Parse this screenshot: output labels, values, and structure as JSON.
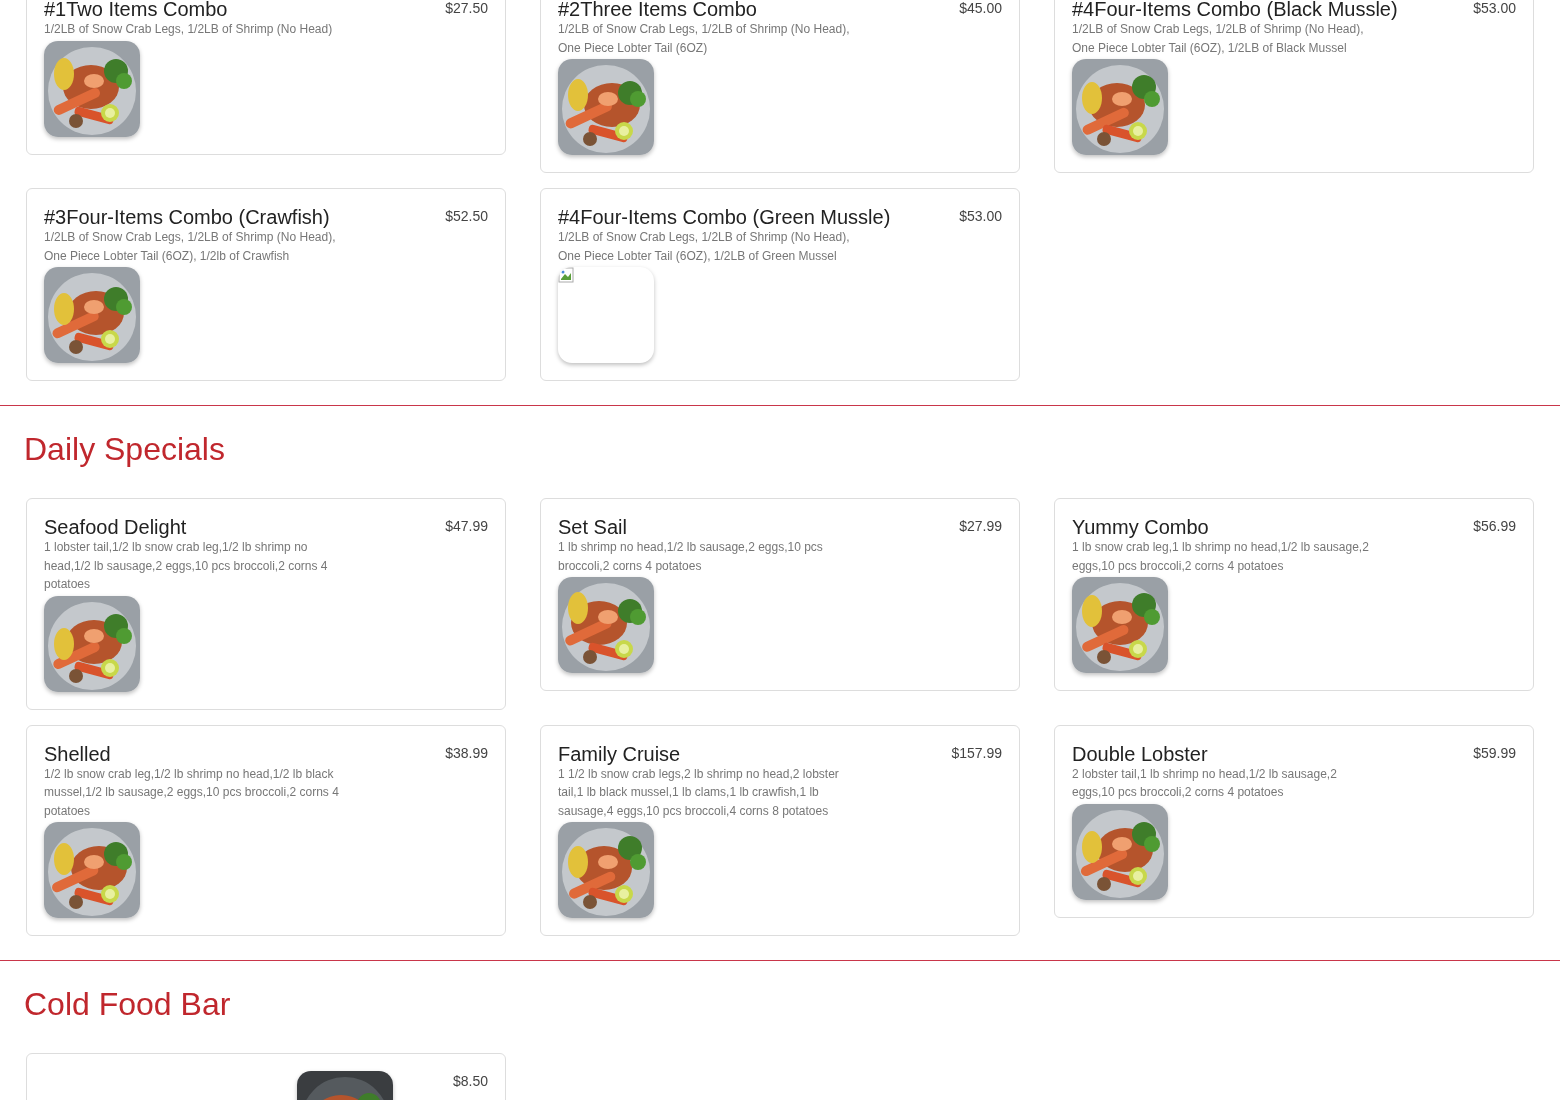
{
  "sections": [
    {
      "items": [
        {
          "kind": "standard",
          "name": "#1Two Items Combo",
          "price": "$27.50",
          "description": "1/2LB of Snow Crab Legs, 1/2LB of Shrimp (No Head)"
        },
        {
          "kind": "standard",
          "name": "#2Three Items Combo",
          "price": "$45.00",
          "description": "1/2LB of Snow Crab Legs, 1/2LB of Shrimp (No Head), One Piece Lobter Tail (6OZ)"
        },
        {
          "kind": "standard",
          "name": "#4Four-Items Combo (Black Mussle)",
          "price": "$53.00",
          "description": "1/2LB of Snow Crab Legs, 1/2LB of Shrimp (No Head), One Piece Lobter Tail (6OZ), 1/2LB of Black Mussel"
        },
        {
          "kind": "standard",
          "name": "#3Four-Items Combo (Crawfish)",
          "price": "$52.50",
          "description": "1/2LB of Snow Crab Legs, 1/2LB of Shrimp (No Head), One Piece Lobter Tail (6OZ), 1/2lb of Crawfish"
        },
        {
          "kind": "broken-image",
          "name": "#4Four-Items Combo (Green Mussle)",
          "price": "$53.00",
          "description": "1/2LB of Snow Crab Legs, 1/2LB of Shrimp (No Head), One Piece Lobter Tail (6OZ), 1/2LB of Green Mussel"
        }
      ]
    },
    {
      "heading": "Daily Specials",
      "items": [
        {
          "kind": "standard",
          "name": "Seafood Delight",
          "price": "$47.99",
          "description": "1 lobster tail,1/2 lb snow crab leg,1/2 lb shrimp no head,1/2 lb sausage,2 eggs,10 pcs broccoli,2 corns 4 potatoes"
        },
        {
          "kind": "standard",
          "name": "Set Sail",
          "price": "$27.99",
          "description": "1 lb shrimp no head,1/2 lb sausage,2 eggs,10 pcs broccoli,2 corns 4 potatoes"
        },
        {
          "kind": "standard",
          "name": "Yummy Combo",
          "price": "$56.99",
          "description": "1 lb snow crab leg,1 lb shrimp no head,1/2 lb sausage,2 eggs,10 pcs broccoli,2 corns 4 potatoes"
        },
        {
          "kind": "standard",
          "name": "Shelled",
          "price": "$38.99",
          "description": "1/2 lb snow crab leg,1/2 lb shrimp no head,1/2 lb black mussel,1/2 lb sausage,2 eggs,10 pcs broccoli,2 corns 4 potatoes"
        },
        {
          "kind": "standard",
          "name": "Family Cruise",
          "price": "$157.99",
          "description": "1 1/2 lb snow crab legs,2 lb shrimp no head,2 lobster tail,1 lb black mussel,1 lb clams,1 lb crawfish,1 lb sausage,4 eggs,10 pcs broccoli,4 corns 8 potatoes"
        },
        {
          "kind": "standard",
          "name": "Double Lobster",
          "price": "$59.99",
          "description": "2 lobster tail,1 lb shrimp no head,1/2 lb sausage,2 eggs,10 pcs broccoli,2 corns 4 potatoes"
        }
      ]
    },
    {
      "heading": "Cold Food Bar",
      "items": [
        {
          "kind": "image-right",
          "price": "$8.50"
        }
      ]
    }
  ]
}
